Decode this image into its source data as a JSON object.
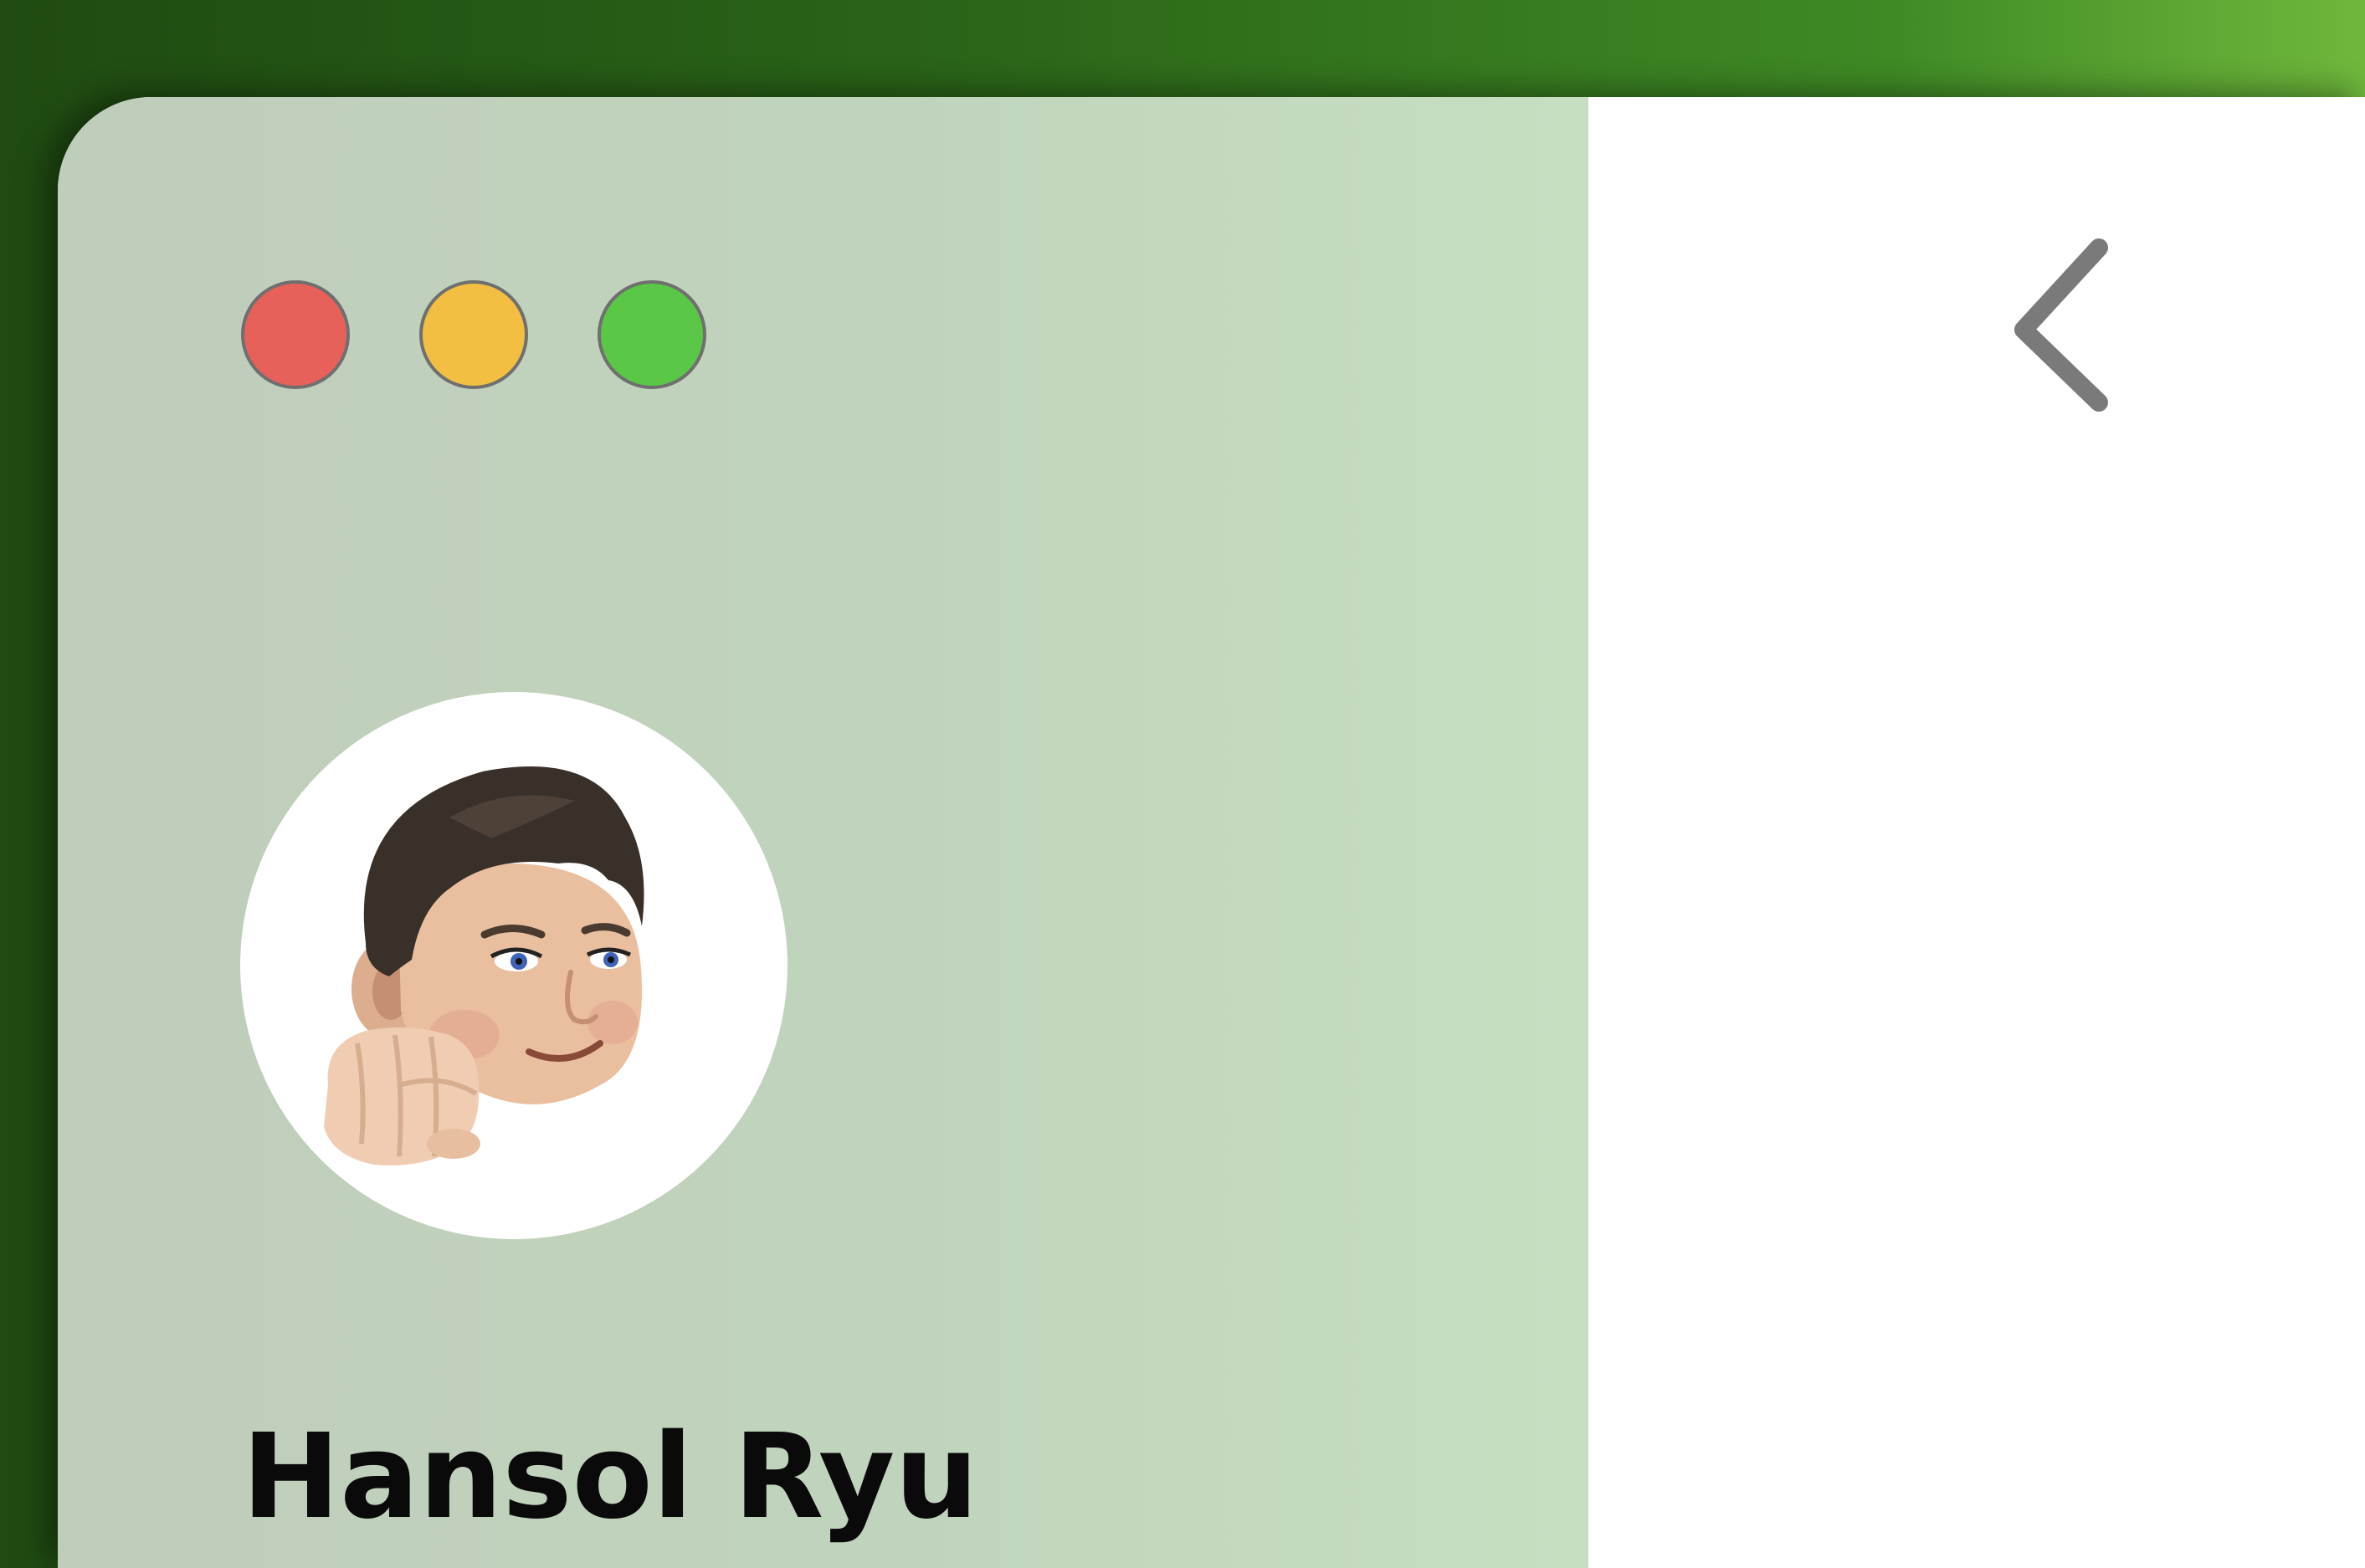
{
  "window": {
    "traffic_lights": [
      {
        "name": "close",
        "color": "#e8605a"
      },
      {
        "name": "minimize",
        "color": "#f2bf43"
      },
      {
        "name": "zoom",
        "color": "#5ac846"
      }
    ]
  },
  "sidebar": {
    "profile": {
      "avatar_icon": "memoji-fist-bump-avatar",
      "name": "Hansol Ryu"
    }
  },
  "toolbar": {
    "back_icon": "chevron-left-icon"
  },
  "colors": {
    "sidebar_background": "#c2d4be",
    "content_background": "#ffffff",
    "desktop_background": "#2a6418"
  }
}
